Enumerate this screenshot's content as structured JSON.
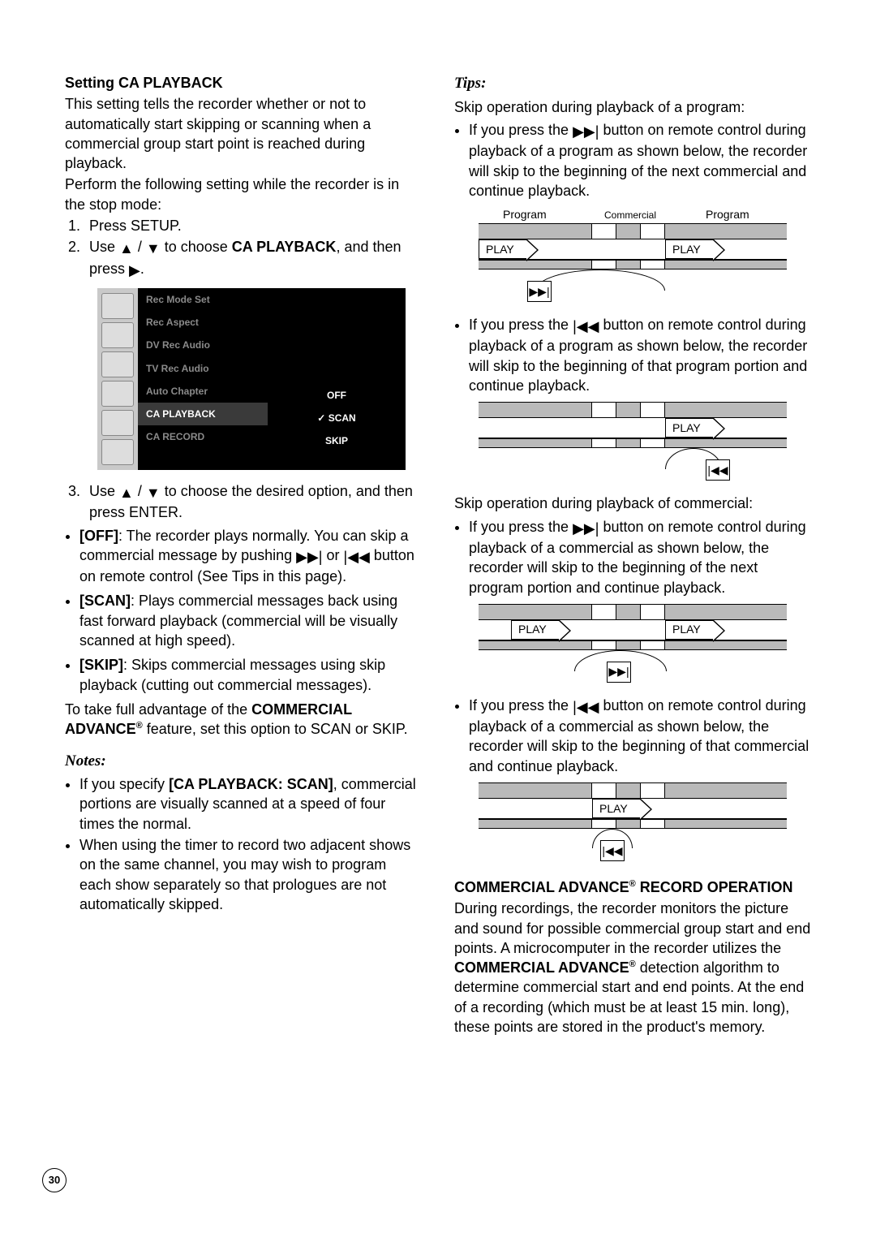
{
  "left": {
    "h1": "Setting CA PLAYBACK",
    "intro1": "This setting tells the recorder whether or not to automatically start skipping or scanning when a commercial group start point is reached during playback.",
    "intro2": "Perform the following setting while the recorder is in the stop mode:",
    "step1": "Press SETUP.",
    "step2a": "Use ",
    "step2b": " / ",
    "step2c": " to choose ",
    "step2d": "CA PLAYBACK",
    "step2e": ", and then press ",
    "step2f": ".",
    "menu": {
      "items": [
        "Rec Mode Set",
        "Rec Aspect",
        "DV Rec Audio",
        "TV Rec Audio",
        "Auto Chapter",
        "CA PLAYBACK",
        "CA RECORD"
      ],
      "values": [
        "OFF",
        "SCAN",
        "SKIP"
      ]
    },
    "step3a": "Use ",
    "step3b": " / ",
    "step3c": " to choose the desired option, and then press ENTER.",
    "opt_off_label": "[OFF]",
    "opt_off_text": ": The recorder plays normally. You can skip a commercial message by pushing ",
    "opt_off_text2": " or ",
    "opt_off_text3": " button on remote control (See Tips in this page).",
    "opt_scan_label": "[SCAN]",
    "opt_scan_text": ": Plays commercial messages back using fast forward playback (commercial will be visually scanned at high speed).",
    "opt_skip_label": "[SKIP]",
    "opt_skip_text": ": Skips commercial messages using skip playback (cutting out commercial messages).",
    "closing1": "To take full advantage of the ",
    "closing2": "COMMERCIAL ADVANCE",
    "closing3": " feature, set this option to SCAN or SKIP.",
    "notes_h": "Notes:",
    "note1a": "If you specify ",
    "note1b": "[CA PLAYBACK: SCAN]",
    "note1c": ", commercial portions are visually scanned at a speed of four times the normal.",
    "note2": "When using the timer to record two adjacent shows on the same channel, you may wish to program each show separately so that prologues are not automatically skipped."
  },
  "right": {
    "tips_h": "Tips:",
    "skip_prog_intro": "Skip operation during playback of a program:",
    "tip1a": "If you press the ",
    "tip1b": " button on remote control during playback of a program as shown below, the recorder will skip to the beginning of the next commercial and continue playback.",
    "diag_labels": {
      "program": "Program",
      "commercial": "Commercial",
      "play": "PLAY"
    },
    "tip2a": "If you press the ",
    "tip2b": " button on remote control during playback of a program as shown below, the recorder will skip to the beginning of that program portion and continue playback.",
    "skip_com_intro": "Skip operation during playback of commercial:",
    "tip3a": "If you press the ",
    "tip3b": " button on remote control during playback of a commercial as shown below, the recorder will skip to the beginning of the next program portion and continue playback.",
    "tip4a": "If you press the ",
    "tip4b": " button on remote control during playback of a commercial as shown below, the recorder will skip to the beginning of that commercial and continue playback.",
    "record_h1": "COMMERCIAL ADVANCE",
    "record_h2": " RECORD OPERATION",
    "record_body1": "During recordings, the recorder monitors the picture and sound for possible commercial group start and end points. A microcomputer in the recorder utilizes the ",
    "record_body2": "COMMERCIAL ADVANCE",
    "record_body3": " detection algorithm to determine commercial start and end points. At the end of a recording (which must be at least 15 min. long), these points are stored in the product's memory."
  },
  "icons": {
    "next": "▶▶|",
    "prev": "|◀◀",
    "up": "▲",
    "down": "▼",
    "right": "▶"
  },
  "page_number": "30"
}
